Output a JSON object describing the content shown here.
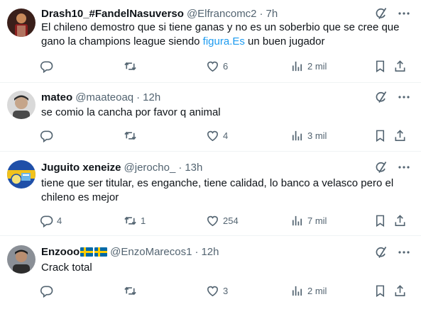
{
  "tweets": [
    {
      "name": "Drash10_#FandelNasuverso",
      "handle": "@Elfrancomc2",
      "time": "7h",
      "text_before": "El chileno demostro que si tiene ganas y no es un soberbio que se cree que gano la champions league siendo ",
      "link": "figura.Es",
      "text_after": " un buen jugador",
      "replies": "",
      "retweets": "",
      "likes": "6",
      "views": "2 mil"
    },
    {
      "name": "mateo",
      "handle": "@maateoaq",
      "time": "12h",
      "text": "se comio la cancha por favor q animal",
      "replies": "",
      "retweets": "",
      "likes": "4",
      "views": "3 mil"
    },
    {
      "name": "Juguito xeneize",
      "handle": "@jerocho_",
      "time": "13h",
      "text": "tiene que ser titular, es enganche, tiene calidad, lo banco a velasco pero el chileno es mejor",
      "replies": "4",
      "retweets": "1",
      "likes": "254",
      "views": "7 mil"
    },
    {
      "name": "Enzooo",
      "handle": "@EnzoMarecos1",
      "time": "12h",
      "text": "Crack total",
      "replies": "",
      "retweets": "",
      "likes": "3",
      "views": "2 mil"
    }
  ],
  "separator": "·",
  "icons": {
    "grok": "grok-icon",
    "more": "more-icon",
    "reply": "reply-icon",
    "retweet": "retweet-icon",
    "like": "heart-icon",
    "views": "views-icon",
    "bookmark": "bookmark-icon",
    "share": "share-icon"
  },
  "colors": {
    "link": "#1d9bf0",
    "secondary": "#536471",
    "text": "#0f1419",
    "flag_blue": "#006aa7",
    "flag_yellow": "#fecc00"
  }
}
